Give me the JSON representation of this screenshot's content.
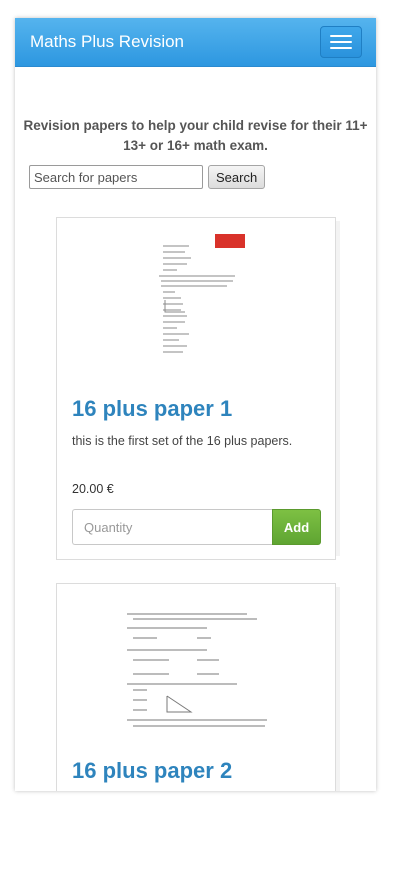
{
  "header": {
    "brand": "Maths Plus Revision",
    "menu_icon": "hamburger-menu-icon",
    "color": "#3aa3e8"
  },
  "intro": {
    "text": "Revision papers to help your child revise for their 11+ 13+ or 16+ math exam."
  },
  "search": {
    "placeholder": "Search for papers",
    "button_label": "Search"
  },
  "products": [
    {
      "title": "16 plus paper 1",
      "description": "this is the first set of the 16 plus papers.",
      "price": "20.00 €",
      "quantity_placeholder": "Quantity",
      "add_label": "Add",
      "thumbnail": "exam-paper-thumbnail-icon"
    },
    {
      "title": "16 plus paper 2",
      "thumbnail": "exam-paper-thumbnail-icon"
    }
  ],
  "colors": {
    "accent": "#2e84bd",
    "add_button": "#6db33f"
  }
}
